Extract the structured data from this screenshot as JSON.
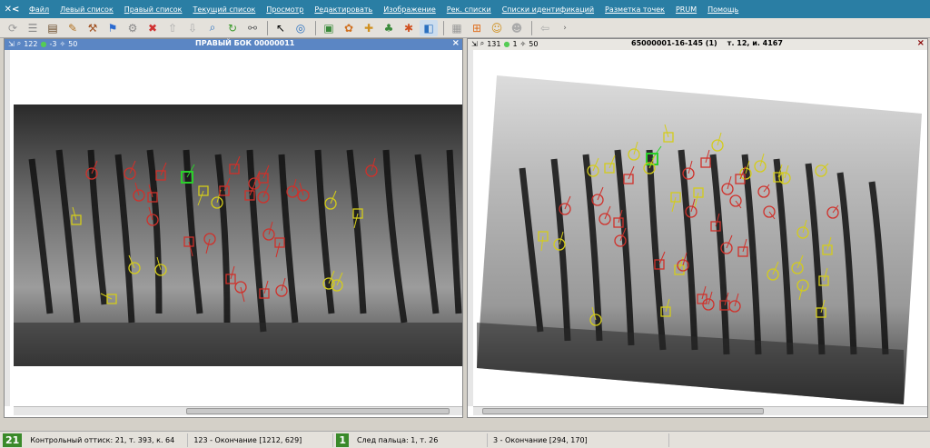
{
  "menu": {
    "logo": "✕<",
    "items": [
      "Файл",
      "Левый список",
      "Правый список",
      "Текущий список",
      "Просмотр",
      "Редактировать",
      "Изображение",
      "Рек. списки",
      "Списки идентификаций",
      "Разметка точек",
      "PRUM",
      "Помощь"
    ]
  },
  "toolbar": {
    "icons": [
      "refresh-icon",
      "list-icon",
      "book-icon",
      "edit-icon",
      "hammer-icon",
      "flag-icon",
      "wrench-icon",
      "delete-icon",
      "arrow-up-icon",
      "arrow-down-icon",
      "search-icon",
      "rotate-icon",
      "link-icon",
      "pointer-icon",
      "circle-icon",
      "image-icon",
      "paint-icon",
      "split-icon",
      "tree-icon",
      "cross-icon",
      "frame-icon",
      "grid-icon",
      "zoom-fit-icon",
      "person-icon",
      "person2-icon",
      "back-icon",
      "chevron-icon"
    ]
  },
  "left_pane": {
    "counter_a": "122",
    "counter_b": "-3",
    "counter_c": "50",
    "title": "ПРАВЫЙ БОК 00000011"
  },
  "right_pane": {
    "counter_a": "131",
    "counter_b": "1",
    "counter_c": "50",
    "title": "65000001-16-145 (1)    т. 12, и. 4167"
  },
  "status": {
    "left_badge": "21",
    "left_text": "Контрольный оттиск: 21, т. 393, к. 64",
    "left_coord": "123 - Окончание [1212, 629]",
    "right_badge": "1",
    "right_text": "След пальца: 1, т. 26",
    "right_coord": "3 - Окончание [294, 170]"
  },
  "colors": {
    "red_marker": "#d0302a",
    "yellow_marker": "#d4cc1a",
    "green_marker": "#2ad02a",
    "menu_bg": "#2a7ea4",
    "active_title_bg": "#5b86c4"
  }
}
